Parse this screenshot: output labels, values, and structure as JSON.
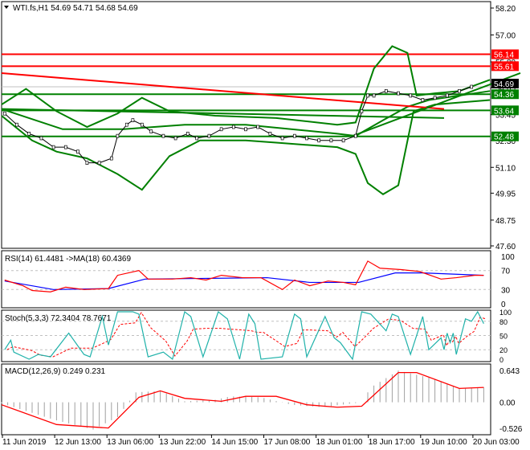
{
  "chart_data": {
    "type": "line",
    "title": "WTI.fs,H1  54.69 54.71 54.68 54.69",
    "price_axis": {
      "ticks": [
        "58.20",
        "57.00",
        "55.80",
        "54.65",
        "53.45",
        "52.30",
        "51.10",
        "49.95",
        "48.75",
        "47.60"
      ],
      "ylim": [
        47.6,
        58.2
      ]
    },
    "time_axis": {
      "labels": [
        "11 Jun 2019",
        "12 Jun 13:00",
        "13 Jun 06:00",
        "13 Jun 22:00",
        "14 Jun 15:00",
        "17 Jun 08:00",
        "18 Jun 01:00",
        "18 Jun 17:00",
        "19 Jun 10:00",
        "20 Jun 03:00"
      ],
      "bars": 160
    },
    "current_price": {
      "value": 54.69,
      "label": "54.69"
    },
    "levels": [
      {
        "value": 56.14,
        "label": "56.14",
        "color": "#ff0000"
      },
      {
        "value": 55.61,
        "label": "55.61",
        "color": "#ff0000"
      },
      {
        "value": 54.36,
        "label": "54.36",
        "color": "#008000"
      },
      {
        "value": 53.64,
        "label": "53.64",
        "color": "#008000"
      },
      {
        "value": 52.48,
        "label": "52.48",
        "color": "#008000"
      }
    ],
    "close": [
      [
        1,
        53.5
      ],
      [
        5,
        53.0
      ],
      [
        9,
        52.6
      ],
      [
        13,
        52.4
      ],
      [
        17,
        52.0
      ],
      [
        21,
        52.0
      ],
      [
        25,
        51.8
      ],
      [
        28,
        51.3
      ],
      [
        32,
        51.3
      ],
      [
        36,
        51.5
      ],
      [
        38,
        52.5
      ],
      [
        41,
        53.0
      ],
      [
        43,
        53.2
      ],
      [
        46,
        53.0
      ],
      [
        49,
        52.7
      ],
      [
        53,
        52.5
      ],
      [
        57,
        52.4
      ],
      [
        61,
        52.6
      ],
      [
        64,
        52.4
      ],
      [
        68,
        52.5
      ],
      [
        72,
        52.8
      ],
      [
        76,
        52.9
      ],
      [
        80,
        52.8
      ],
      [
        84,
        52.9
      ],
      [
        88,
        52.6
      ],
      [
        92,
        52.4
      ],
      [
        96,
        52.5
      ],
      [
        100,
        52.4
      ],
      [
        104,
        52.3
      ],
      [
        108,
        52.3
      ],
      [
        112,
        52.3
      ],
      [
        116,
        52.5
      ],
      [
        118,
        53.6
      ],
      [
        120,
        54.3
      ],
      [
        122,
        54.3
      ],
      [
        126,
        54.5
      ],
      [
        130,
        54.4
      ],
      [
        134,
        54.3
      ],
      [
        138,
        54.1
      ],
      [
        142,
        54.2
      ],
      [
        146,
        54.3
      ],
      [
        150,
        54.5
      ],
      [
        154,
        54.69
      ]
    ],
    "bollinger_upper": [
      [
        0,
        53.9
      ],
      [
        8,
        54.6
      ],
      [
        18,
        53.6
      ],
      [
        28,
        52.9
      ],
      [
        38,
        53.5
      ],
      [
        46,
        54.2
      ],
      [
        55,
        53.6
      ],
      [
        70,
        53.4
      ],
      [
        90,
        53.3
      ],
      [
        110,
        53.0
      ],
      [
        116,
        53.1
      ],
      [
        122,
        55.5
      ],
      [
        128,
        56.5
      ],
      [
        133,
        56.2
      ],
      [
        136,
        54.3
      ],
      [
        142,
        54.4
      ],
      [
        150,
        54.5
      ],
      [
        160,
        55.0
      ]
    ],
    "bollinger_middle": [
      [
        0,
        53.7
      ],
      [
        20,
        52.8
      ],
      [
        40,
        52.8
      ],
      [
        60,
        53.0
      ],
      [
        80,
        53.0
      ],
      [
        110,
        52.6
      ],
      [
        116,
        52.5
      ],
      [
        125,
        53.2
      ],
      [
        133,
        53.8
      ],
      [
        140,
        54.1
      ],
      [
        160,
        54.5
      ]
    ],
    "bollinger_lower": [
      [
        0,
        53.4
      ],
      [
        10,
        52.3
      ],
      [
        18,
        51.8
      ],
      [
        28,
        51.5
      ],
      [
        38,
        50.8
      ],
      [
        46,
        50.1
      ],
      [
        55,
        51.6
      ],
      [
        65,
        52.3
      ],
      [
        80,
        52.3
      ],
      [
        90,
        52.2
      ],
      [
        110,
        52.0
      ],
      [
        116,
        51.7
      ],
      [
        120,
        50.4
      ],
      [
        125,
        49.9
      ],
      [
        130,
        50.3
      ],
      [
        135,
        53.6
      ],
      [
        142,
        53.9
      ],
      [
        160,
        54.1
      ]
    ],
    "trendlines": [
      {
        "color": "#ff0000",
        "points": [
          [
            0,
            55.3
          ],
          [
            145,
            53.7
          ]
        ]
      },
      {
        "color": "#008000",
        "points": [
          [
            0,
            53.7
          ],
          [
            145,
            53.3
          ]
        ]
      },
      {
        "color": "#008000",
        "points": [
          [
            115,
            52.5
          ],
          [
            170,
            55.3
          ]
        ]
      }
    ],
    "rsi": {
      "label": "RSI(14) 61.4481  ->MA(18) 60.4369",
      "ticks": [
        "100",
        "70",
        "30",
        "0"
      ],
      "rsi": [
        [
          1,
          50
        ],
        [
          7,
          38
        ],
        [
          10,
          28
        ],
        [
          16,
          25
        ],
        [
          21,
          35
        ],
        [
          27,
          30
        ],
        [
          35,
          32
        ],
        [
          38,
          60
        ],
        [
          45,
          70
        ],
        [
          48,
          52
        ],
        [
          56,
          52
        ],
        [
          62,
          55
        ],
        [
          67,
          50
        ],
        [
          72,
          60
        ],
        [
          79,
          55
        ],
        [
          85,
          55
        ],
        [
          92,
          30
        ],
        [
          96,
          50
        ],
        [
          101,
          38
        ],
        [
          107,
          48
        ],
        [
          112,
          45
        ],
        [
          116,
          40
        ],
        [
          120,
          90
        ],
        [
          124,
          75
        ],
        [
          131,
          72
        ],
        [
          137,
          68
        ],
        [
          144,
          52
        ],
        [
          149,
          55
        ],
        [
          155,
          60
        ],
        [
          158,
          60
        ]
      ],
      "ma": [
        [
          1,
          48
        ],
        [
          17,
          30
        ],
        [
          35,
          32
        ],
        [
          47,
          52
        ],
        [
          87,
          55
        ],
        [
          101,
          45
        ],
        [
          117,
          45
        ],
        [
          129,
          65
        ],
        [
          138,
          65
        ],
        [
          158,
          60
        ]
      ]
    },
    "stoch": {
      "label": "Stoch(5,3,3) 72.3404 78.7671",
      "ticks": [
        "100",
        "80",
        "50",
        "20",
        "0"
      ],
      "main": [
        [
          1,
          20
        ],
        [
          3,
          40
        ],
        [
          4,
          15
        ],
        [
          9,
          0
        ],
        [
          12,
          10
        ],
        [
          16,
          5
        ],
        [
          22,
          55
        ],
        [
          27,
          10
        ],
        [
          29,
          5
        ],
        [
          33,
          90
        ],
        [
          35,
          30
        ],
        [
          38,
          100
        ],
        [
          43,
          100
        ],
        [
          45,
          95
        ],
        [
          48,
          5
        ],
        [
          53,
          15
        ],
        [
          56,
          0
        ],
        [
          60,
          100
        ],
        [
          62,
          90
        ],
        [
          66,
          5
        ],
        [
          71,
          100
        ],
        [
          74,
          85
        ],
        [
          78,
          0
        ],
        [
          81,
          95
        ],
        [
          83,
          75
        ],
        [
          85,
          0
        ],
        [
          92,
          5
        ],
        [
          96,
          95
        ],
        [
          98,
          85
        ],
        [
          100,
          5
        ],
        [
          106,
          90
        ],
        [
          109,
          45
        ],
        [
          111,
          35
        ],
        [
          115,
          0
        ],
        [
          118,
          100
        ],
        [
          121,
          95
        ],
        [
          126,
          60
        ],
        [
          128,
          95
        ],
        [
          130,
          90
        ],
        [
          134,
          10
        ],
        [
          138,
          90
        ],
        [
          140,
          20
        ],
        [
          144,
          45
        ],
        [
          145,
          20
        ],
        [
          146,
          55
        ],
        [
          147,
          35
        ],
        [
          148,
          55
        ],
        [
          149,
          10
        ],
        [
          152,
          85
        ],
        [
          154,
          80
        ],
        [
          156,
          100
        ],
        [
          158,
          75
        ]
      ]
    },
    "macd": {
      "label": "MACD(12,26,9) 0.249 0.231",
      "ticks": [
        "0.643",
        "0.00",
        "-0.526"
      ],
      "ylim": [
        -0.526,
        0.643
      ],
      "histogram": [
        [
          0,
          -0.02
        ],
        [
          17,
          -0.35
        ],
        [
          30,
          -0.55
        ],
        [
          38,
          -0.3
        ],
        [
          44,
          0.2
        ],
        [
          52,
          0.23
        ],
        [
          60,
          0.02
        ],
        [
          70,
          0.05
        ],
        [
          75,
          0.12
        ],
        [
          85,
          0.1
        ],
        [
          95,
          -0.05
        ],
        [
          105,
          -0.1
        ],
        [
          118,
          0
        ],
        [
          121,
          0.3
        ],
        [
          130,
          0.64
        ],
        [
          140,
          0.5
        ],
        [
          150,
          0.28
        ],
        [
          158,
          0.3
        ]
      ],
      "signal": [
        [
          0,
          -0.05
        ],
        [
          18,
          -0.45
        ],
        [
          35,
          -0.52
        ],
        [
          45,
          0.1
        ],
        [
          52,
          0.23
        ],
        [
          60,
          0.08
        ],
        [
          72,
          0.02
        ],
        [
          80,
          0.12
        ],
        [
          90,
          0.12
        ],
        [
          100,
          -0.05
        ],
        [
          110,
          -0.1
        ],
        [
          118,
          -0.08
        ],
        [
          130,
          0.6
        ],
        [
          136,
          0.6
        ],
        [
          150,
          0.28
        ],
        [
          158,
          0.3
        ]
      ]
    },
    "colors": {
      "up_level": "#ff0000",
      "down_level": "#008000",
      "rsi": "#ff0000",
      "rsi_ma": "#0000ff",
      "stoch_main": "#20b2aa",
      "stoch_signal": "#ff0000",
      "macd_hist": "#a0a0a0",
      "macd_signal": "#ff0000"
    }
  }
}
